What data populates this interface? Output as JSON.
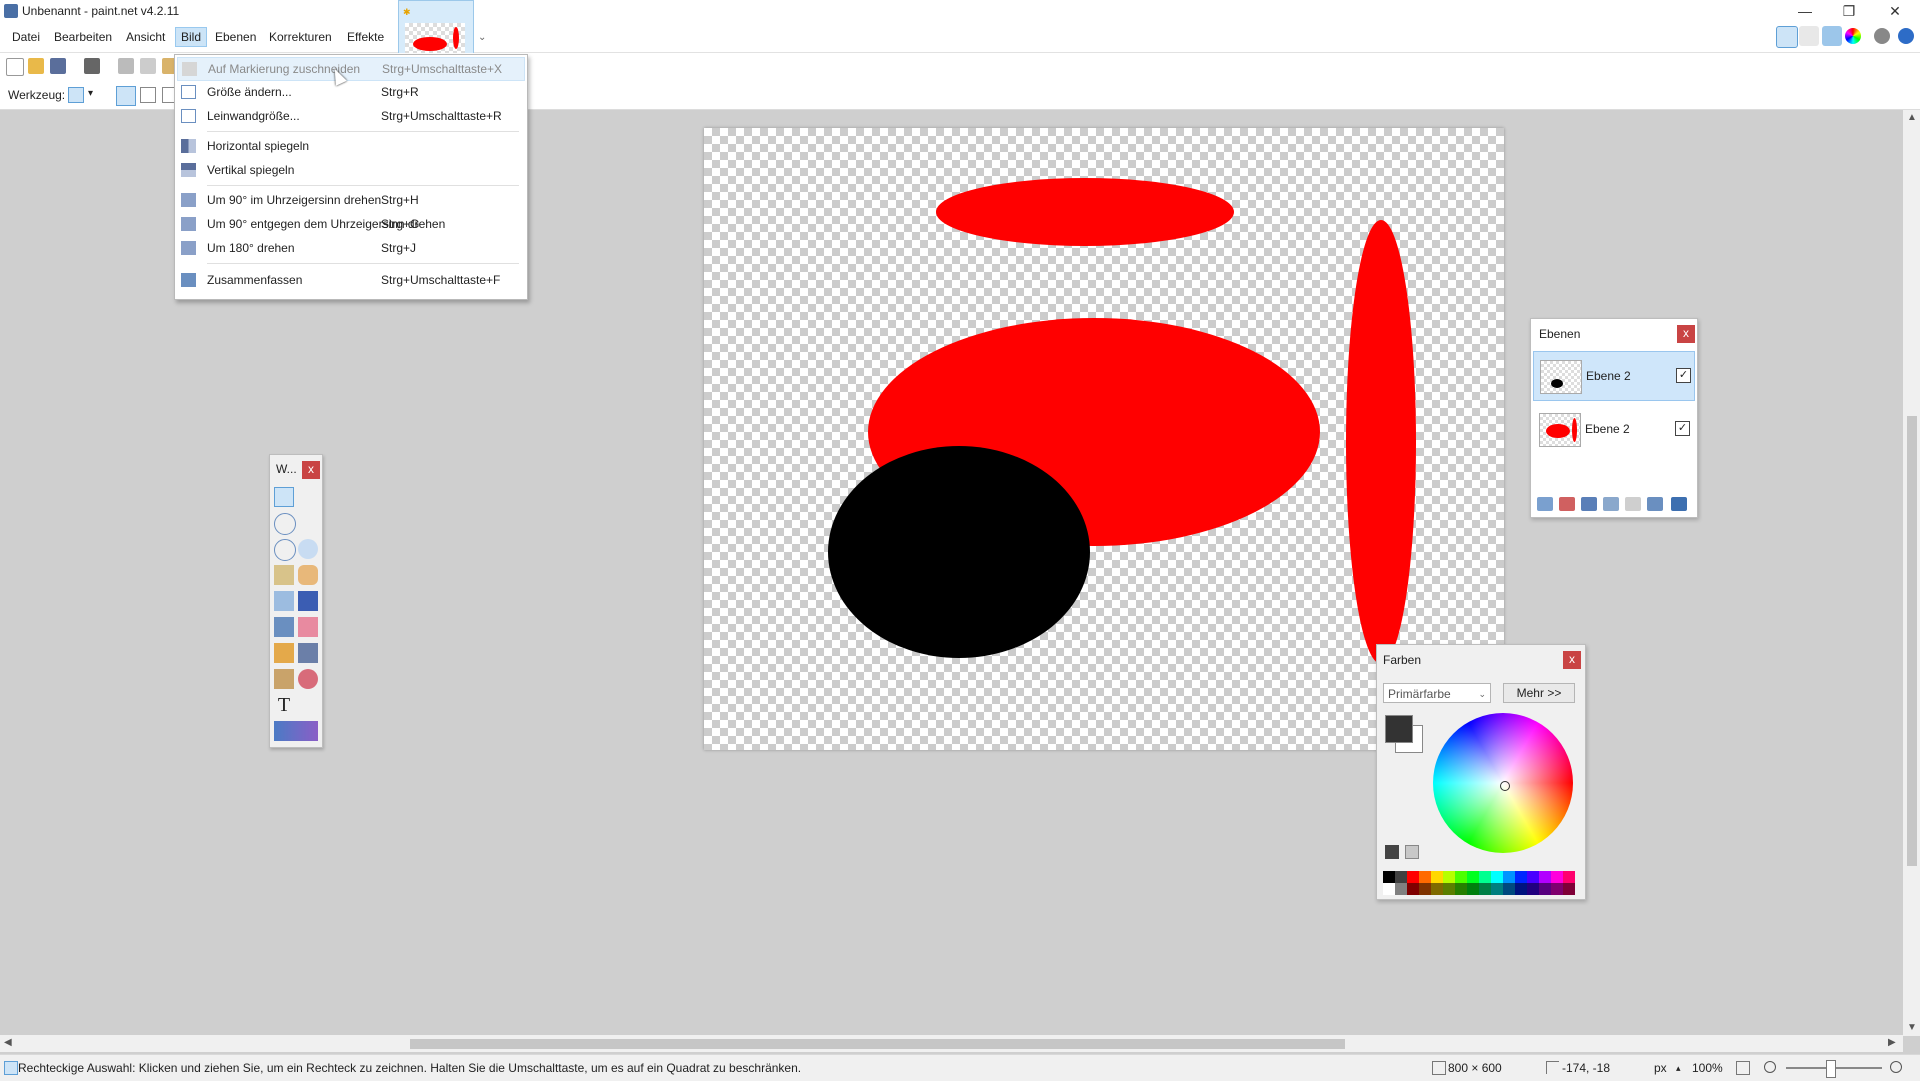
{
  "window": {
    "title": "Unbenannt - paint.net v4.2.11",
    "minimize": "—",
    "maximize": "❐",
    "close": "✕"
  },
  "menubar": {
    "items": [
      "Datei",
      "Bearbeiten",
      "Ansicht",
      "Bild",
      "Ebenen",
      "Korrekturen",
      "Effekte"
    ],
    "active": "Bild"
  },
  "image_tab": {
    "dropdown": "⌄",
    "modified_marker": "✱"
  },
  "toolbar": {
    "tool_label": "Werkzeug:",
    "tool_dropdown": "▾"
  },
  "image_menu": {
    "items": [
      {
        "label": "Auf Markierung zuschneiden",
        "shortcut": "Strg+Umschalttaste+X",
        "disabled": true
      },
      {
        "label": "Größe ändern...",
        "shortcut": "Strg+R"
      },
      {
        "label": "Leinwandgröße...",
        "shortcut": "Strg+Umschalttaste+R"
      },
      {
        "label": "Horizontal spiegeln",
        "shortcut": ""
      },
      {
        "label": "Vertikal spiegeln",
        "shortcut": ""
      },
      {
        "label": "Um 90° im Uhrzeigersinn drehen",
        "shortcut": "Strg+H"
      },
      {
        "label": "Um 90° entgegen dem Uhrzeigersinn drehen",
        "shortcut": "Strg+G"
      },
      {
        "label": "Um 180° drehen",
        "shortcut": "Strg+J"
      },
      {
        "label": "Zusammenfassen",
        "shortcut": "Strg+Umschalttaste+F"
      }
    ]
  },
  "tools_window": {
    "title": "W...",
    "close": "x",
    "text_tool": "T"
  },
  "layers_window": {
    "title": "Ebenen",
    "close": "x",
    "layers": [
      {
        "name": "Ebene 2",
        "visible": "✓"
      },
      {
        "name": "Ebene 2",
        "visible": "✓"
      }
    ]
  },
  "colors_window": {
    "title": "Farben",
    "close": "x",
    "select_value": "Primärfarbe",
    "select_chevron": "⌄",
    "more_button": "Mehr >>",
    "primary_color": "#333333",
    "secondary_color": "#ffffff",
    "palette": [
      "#000000",
      "#404040",
      "#ff0000",
      "#ff6a00",
      "#ffd800",
      "#b6ff00",
      "#4cff00",
      "#00ff21",
      "#00ff90",
      "#00ffff",
      "#0094ff",
      "#0026ff",
      "#4800ff",
      "#b200ff",
      "#ff00dc",
      "#ff006e",
      "#ffffff",
      "#808080",
      "#7f0000",
      "#7f3300",
      "#7f6a00",
      "#5b7f00",
      "#267f00",
      "#007f0e",
      "#007f46",
      "#007f7f",
      "#004a7f",
      "#00137f",
      "#21007f",
      "#57007f",
      "#7f006e",
      "#7f0037"
    ]
  },
  "status": {
    "hint": "Rechteckige Auswahl: Klicken und ziehen Sie, um ein Rechteck zu zeichnen. Halten Sie die Umschalttaste, um es auf ein Quadrat zu beschränken.",
    "image_size": "800 × 600",
    "cursor_pos": "-174, -18",
    "unit": "px",
    "unit_chevron": "▴",
    "zoom": "100%"
  },
  "colors": {
    "red": "#ff0000",
    "black": "#000000",
    "menu_highlight": "#cce4f7"
  }
}
